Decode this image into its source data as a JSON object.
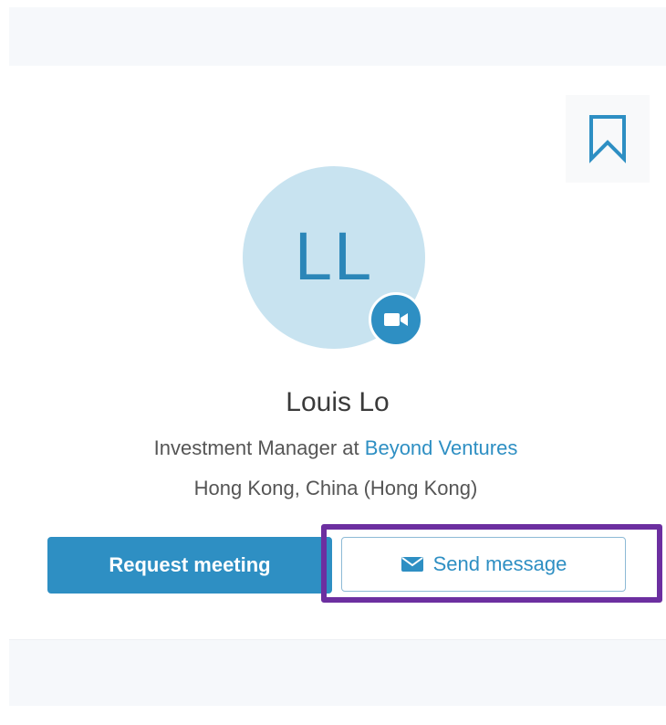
{
  "profile": {
    "initials": "LL",
    "name": "Louis Lo",
    "title_prefix": "Investment Manager at",
    "company": "Beyond Ventures",
    "location": "Hong Kong, China (Hong Kong)"
  },
  "actions": {
    "request_meeting_label": "Request meeting",
    "send_message_label": "Send message"
  },
  "icons": {
    "bookmark": "bookmark-icon",
    "video": "video-camera-icon",
    "message": "envelope-icon"
  },
  "colors": {
    "accent": "#2e8fc3",
    "avatar_bg": "#c8e3f0",
    "highlight": "#6c2fa0"
  }
}
